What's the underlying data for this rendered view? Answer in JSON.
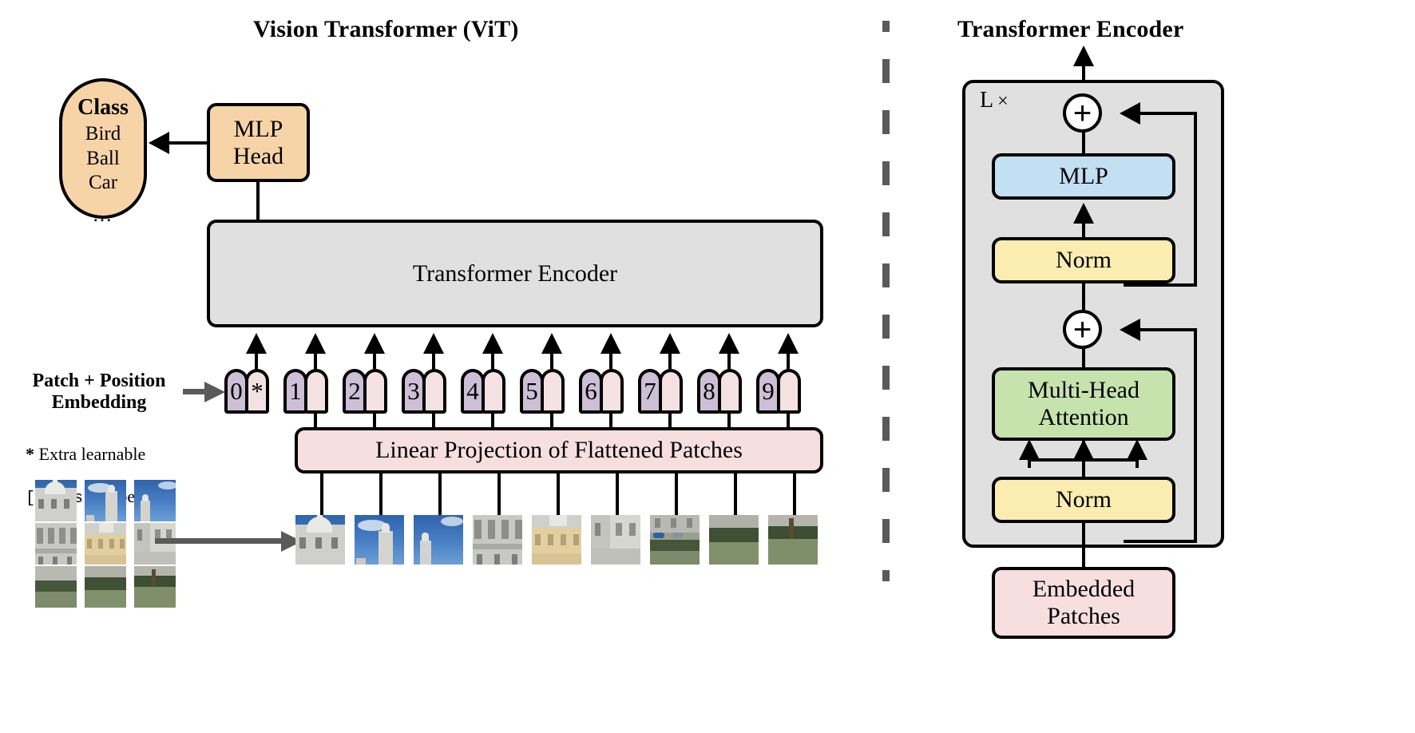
{
  "diagram": {
    "left_panel": {
      "title": "Vision Transformer (ViT)",
      "class_head": {
        "header": "Class",
        "labels": [
          "Bird",
          "Ball",
          "Car"
        ],
        "ellipsis": "..."
      },
      "mlp_head": {
        "label": "MLP\nHead"
      },
      "encoder": {
        "label": "Transformer Encoder"
      },
      "embedding_label": "Patch + Position\nEmbedding",
      "footnote": {
        "star": "*",
        "line1_a": " Extra learnable",
        "mono": "[class]",
        "line2_b": " embedding"
      },
      "linear_projection": {
        "label": "Linear Projection of Flattened Patches"
      },
      "tokens": [
        {
          "position": "0",
          "patch": "*"
        },
        {
          "position": "1",
          "patch": ""
        },
        {
          "position": "2",
          "patch": ""
        },
        {
          "position": "3",
          "patch": ""
        },
        {
          "position": "4",
          "patch": ""
        },
        {
          "position": "5",
          "patch": ""
        },
        {
          "position": "6",
          "patch": ""
        },
        {
          "position": "7",
          "patch": ""
        },
        {
          "position": "8",
          "patch": ""
        },
        {
          "position": "9",
          "patch": ""
        }
      ],
      "patch_count": 9,
      "source_image_alt": "Photograph of a baroque palace facade with blue sky and garden hedges"
    },
    "right_panel": {
      "title": "Transformer Encoder",
      "repeat_label": "L",
      "repeat_times": "×",
      "blocks": {
        "mlp": "MLP",
        "norm_top": "Norm",
        "attention": "Multi-Head\nAttention",
        "norm_bottom": "Norm",
        "embedded_patches": "Embedded\nPatches"
      },
      "residual_add": "+"
    },
    "colors": {
      "orange": "#f7d4a8",
      "grey": "#e0e0e0",
      "pink": "#f7dfdf",
      "blue": "#c3dff2",
      "yellow": "#fbecb0",
      "green": "#c6e3ae",
      "purple_token": "#cdbfd6",
      "pink_token": "#f4e2e2",
      "stroke": "#000000",
      "grey_arrow": "#5a5a5a"
    }
  }
}
